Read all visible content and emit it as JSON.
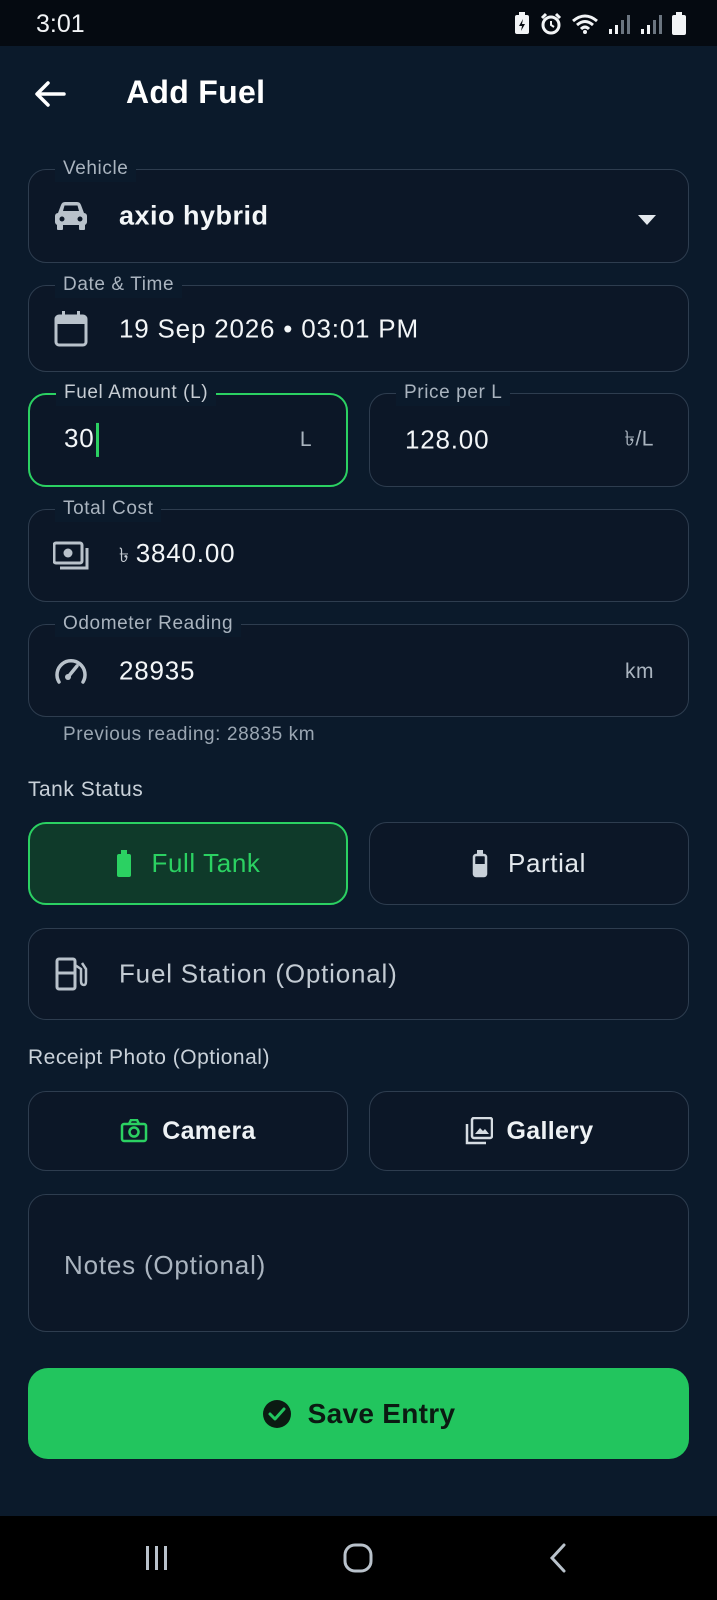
{
  "status_bar": {
    "time": "3:01",
    "icons": [
      "battery-saver-icon",
      "alarm-icon",
      "wifi-icon",
      "signal-icon",
      "signal-icon",
      "battery-icon"
    ]
  },
  "app_bar": {
    "title": "Add Fuel",
    "back_icon": "arrow-left-icon"
  },
  "form": {
    "vehicle": {
      "label": "Vehicle",
      "value": "axio hybrid",
      "icon": "car-icon"
    },
    "date_time": {
      "label": "Date & Time",
      "value": "19 Sep 2026 • 03:01 PM",
      "icon": "calendar-icon"
    },
    "fuel_amount": {
      "label": "Fuel Amount (L)",
      "value": "30",
      "suffix": "L"
    },
    "price_per_l": {
      "label": "Price per L",
      "value": "128.00",
      "suffix": "৳/L"
    },
    "total_cost": {
      "label": "Total Cost",
      "currency": "৳",
      "value": "3840.00",
      "icon": "money-icon"
    },
    "odometer": {
      "label": "Odometer Reading",
      "value": "28935",
      "suffix": "km",
      "icon": "speedometer-icon",
      "helper": "Previous reading: 28835 km"
    },
    "tank_status": {
      "label": "Tank Status",
      "options": [
        {
          "label": "Full Tank",
          "selected": true,
          "icon": "battery-full-icon"
        },
        {
          "label": "Partial",
          "selected": false,
          "icon": "battery-partial-icon"
        }
      ]
    },
    "fuel_station": {
      "placeholder": "Fuel Station (Optional)",
      "icon": "gas-station-icon"
    },
    "receipt": {
      "label": "Receipt Photo (Optional)",
      "camera_label": "Camera",
      "gallery_label": "Gallery"
    },
    "notes": {
      "placeholder": "Notes (Optional)"
    },
    "save_label": "Save Entry"
  },
  "colors": {
    "background": "#0b1a2b",
    "accent": "#22c55e",
    "border": "#2e3d4f"
  }
}
